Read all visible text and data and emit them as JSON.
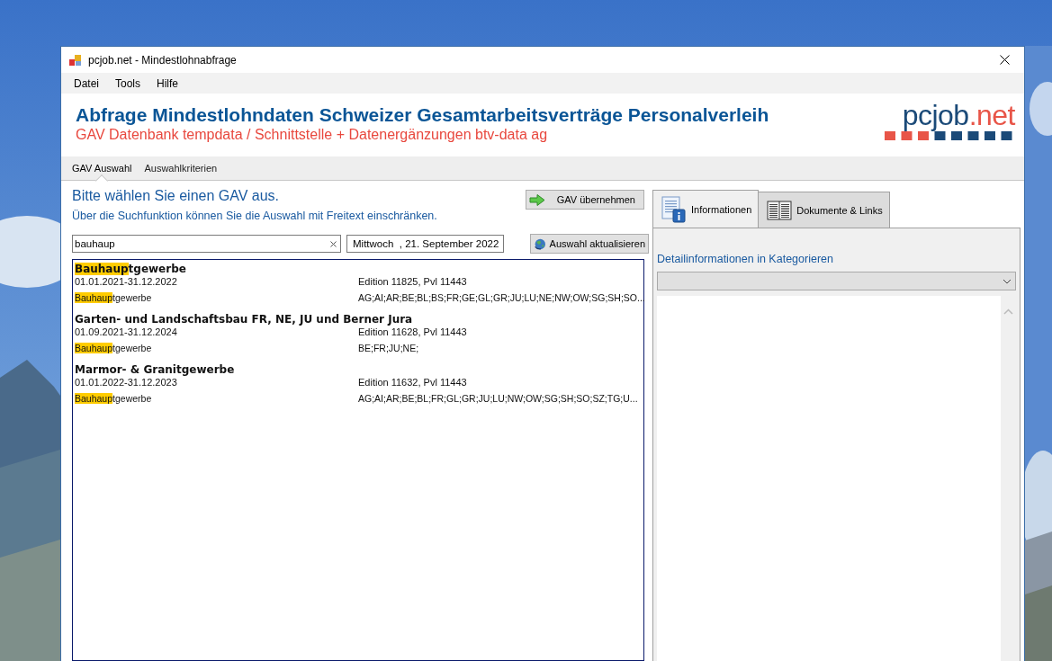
{
  "window": {
    "title": "pcjob.net - Mindestlohnabfrage"
  },
  "menu": [
    {
      "label": "Datei"
    },
    {
      "label": "Tools"
    },
    {
      "label": "Hilfe"
    }
  ],
  "header": {
    "title": "Abfrage Mindestlohndaten Schweizer Gesamtarbeitsverträge Personalverleih",
    "subtitle": "GAV Datenbank tempdata / Schnittstelle + Datenergänzungen btv-data ag",
    "logo": {
      "main": "pcjob",
      "accent": ".net"
    }
  },
  "nav_tabs": [
    {
      "label": "GAV Auswahl",
      "selected": true
    },
    {
      "label": "Auswahlkriterien",
      "selected": false
    }
  ],
  "left": {
    "heading": "Bitte wählen Sie einen GAV aus.",
    "hint": "Über die Suchfunktion können Sie die Auswahl mit Freitext einschränken.",
    "accept_button": "GAV übernehmen",
    "search": {
      "value": "bauhaup"
    },
    "date": "Mittwoch  , 21. September 2022",
    "refresh_button": "Auswahl aktualisieren",
    "results": [
      {
        "title": [
          {
            "text": "Bauhaup",
            "highlighted": true
          },
          {
            "text": "tgewerbe",
            "highlighted": false
          }
        ],
        "period": "01.01.2021-31.12.2022",
        "edition": "Edition 11825, Pvl 11443",
        "tag": [
          {
            "text": "Bauhaup",
            "highlighted": true
          },
          {
            "text": "tgewerbe",
            "highlighted": false
          }
        ],
        "cantons": "AG;AI;AR;BE;BL;BS;FR;GE;GL;GR;JU;LU;NE;NW;OW;SG;SH;SO..."
      },
      {
        "title": [
          {
            "text": "Garten- und Landschaftsbau FR, NE, JU und Berner Jura",
            "highlighted": false
          }
        ],
        "period": "01.09.2021-31.12.2024",
        "edition": "Edition 11628, Pvl 11443",
        "tag": [
          {
            "text": "Bauhaup",
            "highlighted": true
          },
          {
            "text": "tgewerbe",
            "highlighted": false
          }
        ],
        "cantons": "BE;FR;JU;NE;"
      },
      {
        "title": [
          {
            "text": "Marmor- & Granitgewerbe",
            "highlighted": false
          }
        ],
        "period": "01.01.2022-31.12.2023",
        "edition": "Edition 11632, Pvl 11443",
        "tag": [
          {
            "text": "Bauhaup",
            "highlighted": true
          },
          {
            "text": "tgewerbe",
            "highlighted": false
          }
        ],
        "cantons": "AG;AI;AR;BE;BL;FR;GL;GR;JU;LU;NW;OW;SG;SH;SO;SZ;TG;U..."
      }
    ]
  },
  "right": {
    "tabs": [
      {
        "label": "Informationen",
        "kind": "info",
        "selected": true
      },
      {
        "label": "Dokumente & Links",
        "kind": "book",
        "selected": false
      }
    ],
    "category_label": "Detailinformationen in Kategorieren"
  }
}
